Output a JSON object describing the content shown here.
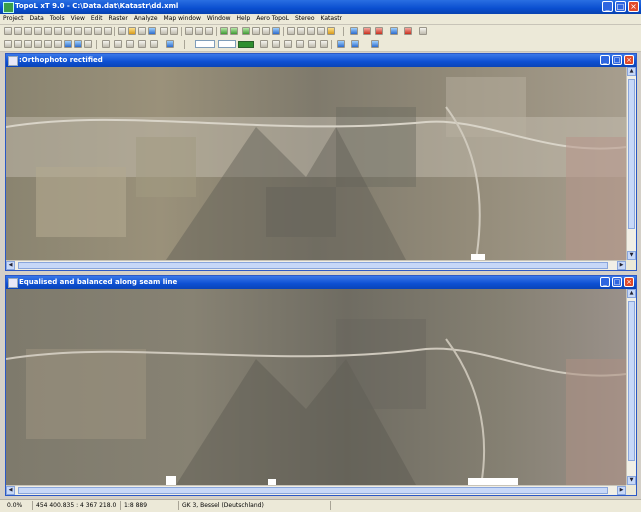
{
  "app": {
    "title": "TopoL xT 9.0 - C:\\Data.dat\\Katastr\\dd.xml"
  },
  "menu": [
    "Project",
    "Data",
    "Tools",
    "View",
    "Edit",
    "Raster",
    "Analyze",
    "Map window",
    "Window",
    "Help",
    "Aero TopoL",
    "Stereo",
    "Katastr"
  ],
  "windows": {
    "top": {
      "title": ":Orthophoto rectified"
    },
    "bottom": {
      "title": "Equalised and balanced along seam line"
    }
  },
  "status": {
    "progress": "0.0%",
    "coords": "454 400.835 : 4 367 218.098",
    "scale": "1:8 889",
    "crs": "GK 3, Bessel (Deutschland)"
  },
  "colors": {
    "titlebar": "#0a4ed0",
    "menubar": "#ece9d8",
    "scroll": "#c7d8f8"
  },
  "icons": {
    "min": "_",
    "max": "□",
    "close": "×",
    "up": "▲",
    "down": "▼",
    "left": "◀",
    "right": "▶"
  }
}
